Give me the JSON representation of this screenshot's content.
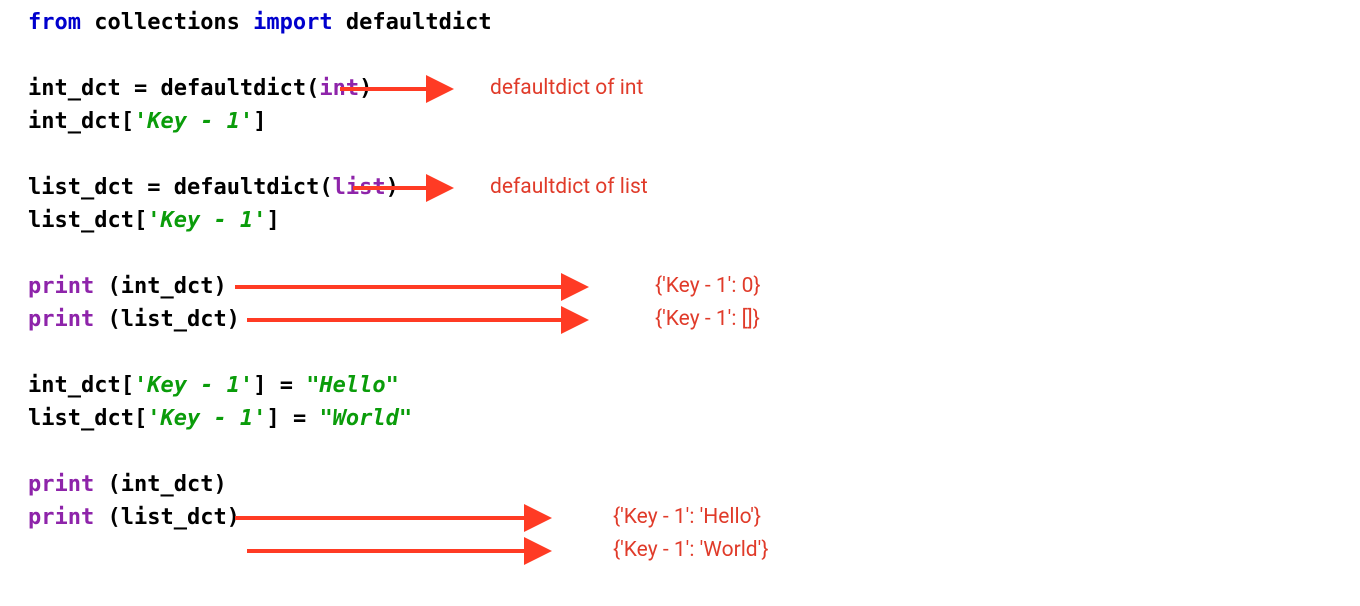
{
  "code": {
    "l01_from": "from",
    "l01_mod": " collections ",
    "l01_import": "import",
    "l01_name": " defaultdict",
    "l03_a": "int_dct ",
    "l03_eq": "=",
    "l03_b": " defaultdict(",
    "l03_int": "int",
    "l03_c": ")",
    "l04_a": "int_dct[",
    "l04_s": "'Key - 1'",
    "l04_b": "]",
    "l06_a": "list_dct ",
    "l06_eq": "=",
    "l06_b": " defaultdict(",
    "l06_list": "list",
    "l06_c": ")",
    "l07_a": "list_dct[",
    "l07_s": "'Key - 1'",
    "l07_b": "]",
    "l09_print": "print",
    "l09_a": " (int_dct)",
    "l10_print": "print",
    "l10_a": " (list_dct)",
    "l12_a": "int_dct[",
    "l12_s": "'Key - 1'",
    "l12_m": "] ",
    "l12_eq": "=",
    "l12_sp": " ",
    "l12_v": "\"Hello\"",
    "l13_a": "list_dct[",
    "l13_s": "'Key - 1'",
    "l13_m": "] ",
    "l13_eq": "=",
    "l13_sp": " ",
    "l13_v": "\"World\"",
    "l15_print": "print",
    "l15_a": " (int_dct)",
    "l16_print": "print",
    "l16_a": " (list_dct)"
  },
  "annotations": {
    "a1": "defaultdict of int",
    "a2": "defaultdict of list",
    "a3": "{'Key - 1': 0}",
    "a4": "{'Key - 1': []}",
    "a5": "{'Key - 1': 'Hello'}",
    "a6": "{'Key - 1': 'World'}"
  },
  "colors": {
    "arrow": "#ff3b24",
    "annotation_text": "#e03b2a",
    "keyword_blue": "#0000cd",
    "keyword_purple": "#8e24aa",
    "string_green": "#0a9c0a",
    "text": "#000000"
  }
}
